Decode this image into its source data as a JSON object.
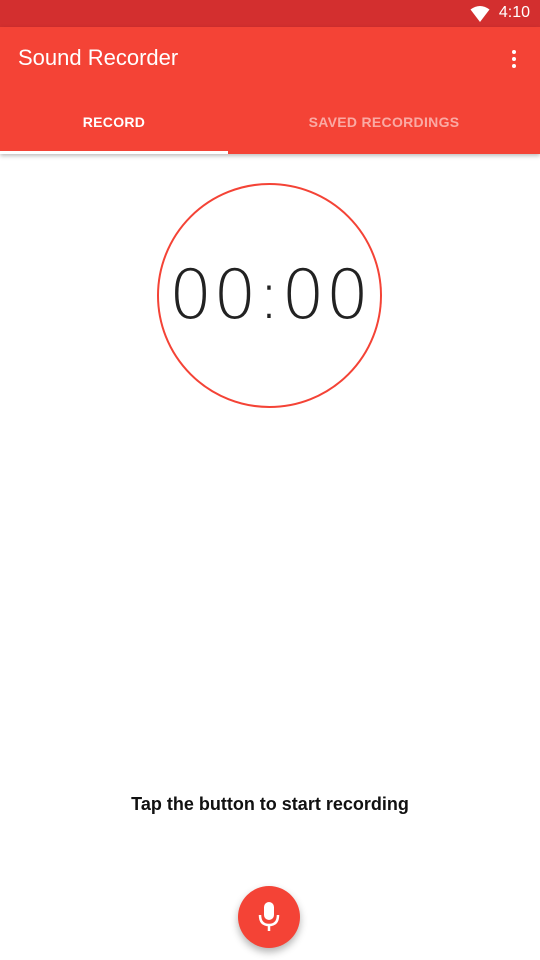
{
  "status_bar": {
    "time": "4:10",
    "icons": [
      "wifi-icon"
    ]
  },
  "app_bar": {
    "title": "Sound Recorder",
    "menu_icon": "more-vert-icon"
  },
  "tabs": [
    {
      "label": "RECORD",
      "selected": true
    },
    {
      "label": "SAVED RECORDINGS",
      "selected": false
    }
  ],
  "timer": {
    "value": "00:00"
  },
  "hint": {
    "text": "Tap the button to start recording"
  },
  "fab": {
    "icon": "microphone-icon"
  },
  "colors": {
    "primary": "#f44336",
    "primary_dark": "#d32f2f",
    "on_primary": "#ffffff",
    "text": "#222222"
  }
}
